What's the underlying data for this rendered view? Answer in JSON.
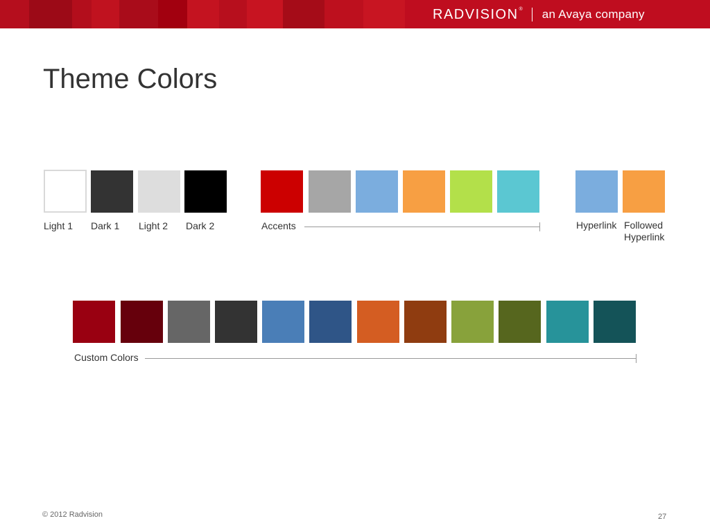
{
  "header": {
    "brand": "RADVISION",
    "brand_mark": "®",
    "tagline": "an Avaya company",
    "color": "#bf0d1f"
  },
  "slide": {
    "title": "Theme Colors",
    "theme_swatches": [
      {
        "label": "Light 1",
        "color": "#ffffff"
      },
      {
        "label": "Dark 1",
        "color": "#333333"
      },
      {
        "label": "Light 2",
        "color": "#dddddd"
      },
      {
        "label": "Dark 2",
        "color": "#000000"
      }
    ],
    "accents": {
      "label": "Accents",
      "colors": [
        "#cc0000",
        "#a6a6a6",
        "#7badde",
        "#f79f43",
        "#b3e04a",
        "#5bc7d2"
      ]
    },
    "hyperlink": {
      "label": "Hyperlink",
      "color": "#7badde"
    },
    "followed_hyperlink": {
      "label": "Followed Hyperlink",
      "label_lines": [
        "Followed",
        "Hyperlink"
      ],
      "color": "#f79f43"
    },
    "custom": {
      "label": "Custom Colors",
      "colors": [
        "#990011",
        "#66000c",
        "#666666",
        "#333333",
        "#4a7eb7",
        "#2f5587",
        "#d45d22",
        "#8f3c10",
        "#88a23b",
        "#56661e",
        "#27939a",
        "#145358"
      ]
    }
  },
  "footer": {
    "copyright": "© 2012 Radvision",
    "page_number": "27"
  }
}
